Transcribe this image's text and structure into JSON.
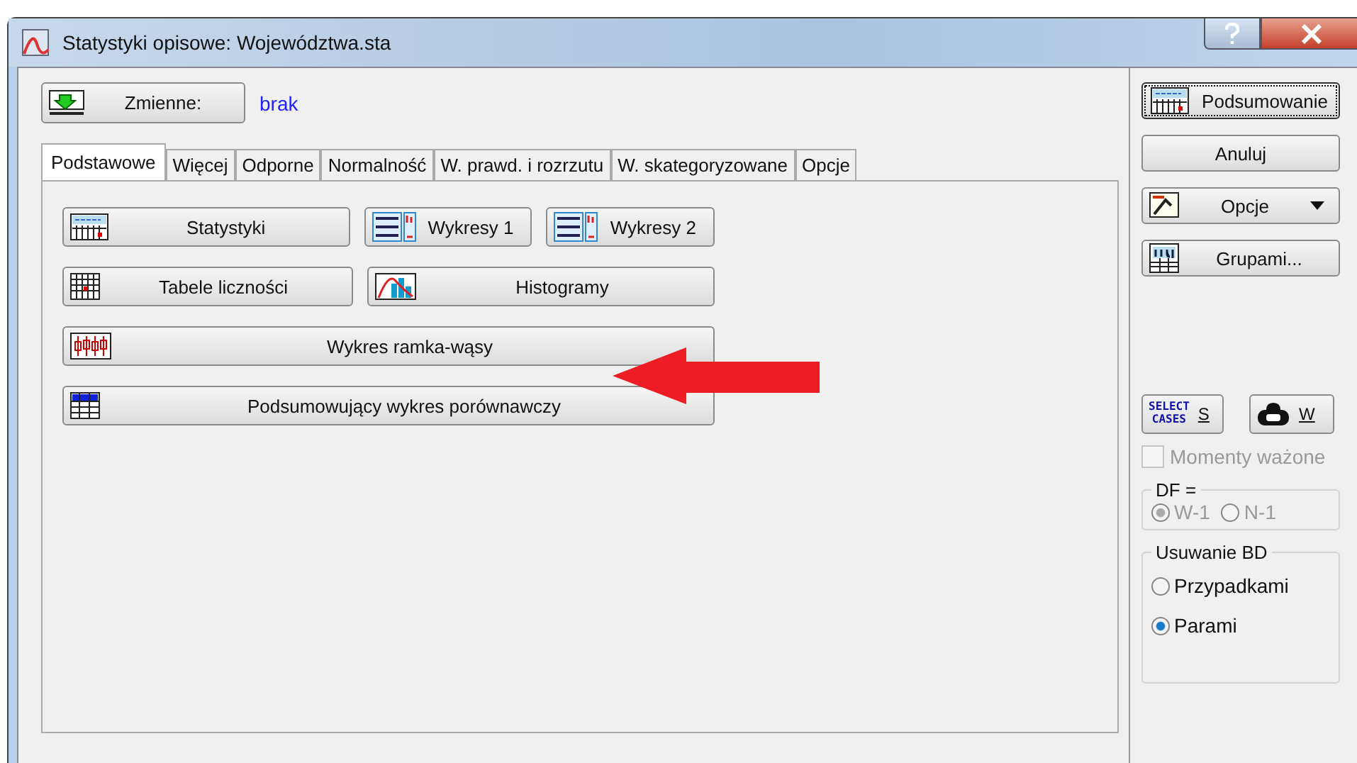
{
  "window": {
    "title": "Statystyki opisowe: Województwa.sta"
  },
  "variables": {
    "button": "Zmienne:",
    "value": "brak"
  },
  "tabs": [
    {
      "label": "Podstawowe",
      "selected": true
    },
    {
      "label": "Więcej",
      "selected": false
    },
    {
      "label": "Odporne",
      "selected": false
    },
    {
      "label": "Normalność",
      "selected": false
    },
    {
      "label": "W. prawd. i rozrzutu",
      "selected": false
    },
    {
      "label": "W. skategoryzowane",
      "selected": false
    },
    {
      "label": "Opcje",
      "selected": false
    }
  ],
  "button_rows": [
    [
      {
        "label": "Statystyki",
        "kind": "summary"
      },
      {
        "label": "Wykresy 1",
        "kind": "graphs"
      },
      {
        "label": "Wykresy 2",
        "kind": "graphs"
      }
    ],
    [
      {
        "label": "Tabele liczności",
        "kind": "table"
      },
      {
        "label": "Histogramy",
        "kind": "histogram"
      }
    ],
    [
      {
        "label": "Wykres ramka-wąsy",
        "kind": "boxplot"
      }
    ],
    [
      {
        "label": "Podsumowujący wykres porównawczy",
        "kind": "grid"
      }
    ]
  ],
  "side_buttons": [
    {
      "label": "Podsumowanie",
      "kind": "summary",
      "focused": true,
      "dropdown": false
    },
    {
      "label": "Anuluj",
      "kind": "plain",
      "focused": false,
      "dropdown": false
    },
    {
      "label": "Opcje",
      "kind": "options",
      "focused": false,
      "dropdown": true
    },
    {
      "label": "Grupami...",
      "kind": "groups",
      "focused": false,
      "dropdown": false
    }
  ],
  "select_cases": {
    "icon_lines": [
      "SELECT",
      "CASES"
    ],
    "label": "S"
  },
  "weight": {
    "label": "W"
  },
  "weighted_moments": {
    "label": "Momenty ważone",
    "checked": false,
    "disabled": true
  },
  "df": {
    "title": "DF =",
    "disabled": true,
    "options": [
      {
        "label": "W-1",
        "selected": true
      },
      {
        "label": "N-1",
        "selected": false
      }
    ]
  },
  "missing_data": {
    "title": "Usuwanie BD",
    "disabled": false,
    "options": [
      {
        "label": "Przypadkami",
        "selected": false
      },
      {
        "label": "Parami",
        "selected": true
      }
    ]
  }
}
